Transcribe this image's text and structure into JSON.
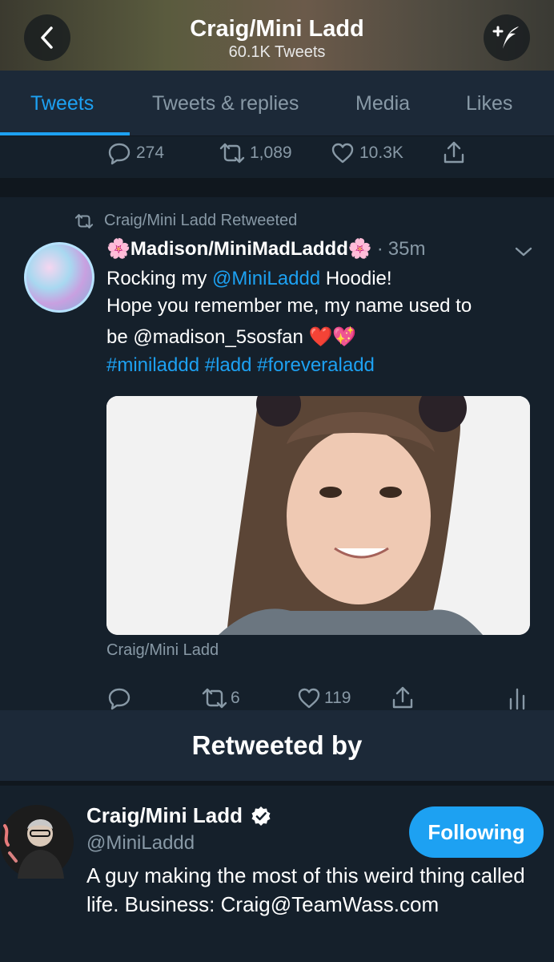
{
  "header": {
    "title": "Craig/Mini Ladd",
    "subtitle": "60.1K Tweets",
    "back_icon": "back-chevron-icon",
    "compose_icon": "compose-tweet-icon"
  },
  "tabs": [
    {
      "label": "Tweets",
      "active": true
    },
    {
      "label": "Tweets & replies",
      "active": false
    },
    {
      "label": "Media",
      "active": false
    },
    {
      "label": "Likes",
      "active": false
    }
  ],
  "previous_tweet_actions": {
    "replies": "274",
    "retweets": "1,089",
    "likes": "10.3K"
  },
  "tweet": {
    "retweet_context": "Craig/Mini Ladd Retweeted",
    "author_emoji": "🌸",
    "author_name": "Madison/MiniMadLaddd",
    "author_emoji_after": "🌸",
    "separator": "·",
    "time": "35m",
    "text_line1_prefix": "Rocking my ",
    "text_line1_mention": "@MiniLaddd",
    "text_line1_suffix": " Hoodie!",
    "text_line2": "Hope you remember me, my name used to",
    "text_line3": "be @madison_5sosfan ❤️💖",
    "hashtags": "#miniladdd #ladd #foreveraladd",
    "media_caption": "Craig/Mini Ladd",
    "retweets": "6",
    "likes": "119"
  },
  "retweeted_by": {
    "title": "Retweeted by",
    "user": {
      "name": "Craig/Mini Ladd",
      "handle": "@MiniLaddd",
      "bio": "A guy making the most of this weird thing called life. Business: Craig@TeamWass.com",
      "follow_label": "Following"
    }
  },
  "colors": {
    "background": "#15202b",
    "accent": "#1da1f2",
    "muted": "#8899a6"
  }
}
